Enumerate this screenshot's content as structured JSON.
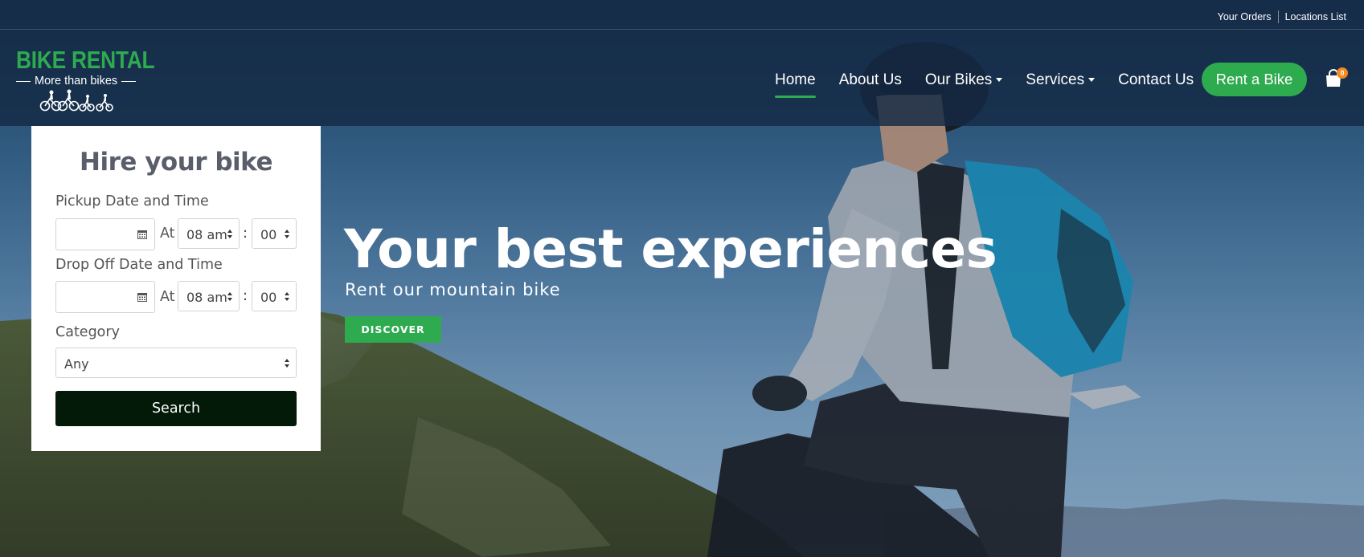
{
  "brand": {
    "name": "BIKE RENTAL",
    "tagline": "More than bikes",
    "logo_icon": "cyclists-icon",
    "accent_color": "#2eab4f"
  },
  "toplinks": [
    "Your Orders",
    "Locations List"
  ],
  "nav": {
    "items": [
      {
        "label": "Home",
        "active": true,
        "dropdown": false
      },
      {
        "label": "About Us",
        "active": false,
        "dropdown": false
      },
      {
        "label": "Our Bikes",
        "active": false,
        "dropdown": true
      },
      {
        "label": "Services",
        "active": false,
        "dropdown": true
      },
      {
        "label": "Contact Us",
        "active": false,
        "dropdown": false
      }
    ],
    "cta_label": "Rent a Bike",
    "cart_icon": "shopping-bag-icon",
    "cart_count": "0",
    "cart_badge_color": "#f28a1d"
  },
  "hero": {
    "title": "Your best experiences",
    "subtitle": "Rent our mountain bike",
    "button_label": "DISCOVER"
  },
  "booking": {
    "title": "Hire your bike",
    "pickup": {
      "label": "Pickup Date and Time",
      "date_value": "",
      "at_label": "At",
      "hour": "08 am",
      "colon": ":",
      "minute": "00"
    },
    "dropoff": {
      "label": "Drop Off Date and Time",
      "date_value": "",
      "at_label": "At",
      "hour": "08 am",
      "colon": ":",
      "minute": "00"
    },
    "category": {
      "label": "Category",
      "value": "Any"
    },
    "search_label": "Search",
    "search_color": "#031a08"
  }
}
